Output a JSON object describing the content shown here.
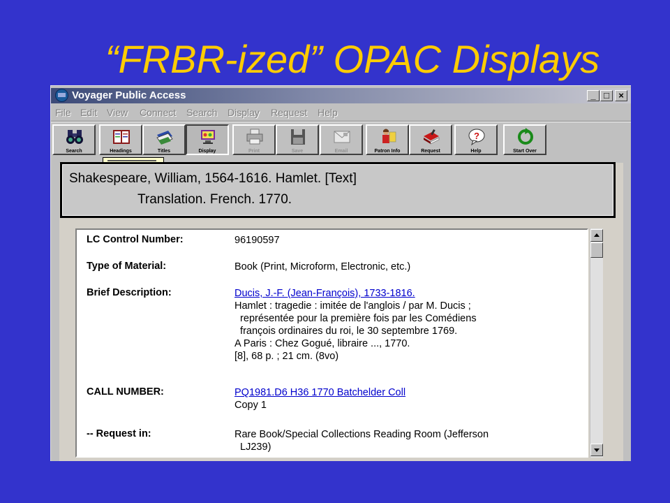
{
  "slide": {
    "title": "“FRBR-ized” OPAC Displays"
  },
  "window": {
    "title": "Voyager Public Access",
    "controls": {
      "minimize": "_",
      "maximize": "□",
      "close": "×"
    }
  },
  "menu": [
    "File",
    "Edit",
    "View",
    "Connect",
    "Search",
    "Display",
    "Request",
    "Help"
  ],
  "toolbar": [
    {
      "label": "Search",
      "icon": "binoculars-icon",
      "enabled": true
    },
    {
      "label": "Headings",
      "icon": "book-list-icon",
      "enabled": true
    },
    {
      "label": "Titles",
      "icon": "books-icon",
      "enabled": true
    },
    {
      "label": "Display",
      "icon": "display-icon",
      "enabled": true
    },
    {
      "label": "Print",
      "icon": "printer-icon",
      "enabled": false
    },
    {
      "label": "Save",
      "icon": "floppy-disk-icon",
      "enabled": false
    },
    {
      "label": "Email",
      "icon": "envelope-icon",
      "enabled": false
    },
    {
      "label": "Patron Info",
      "icon": "patron-icon",
      "enabled": true
    },
    {
      "label": "Request",
      "icon": "request-book-icon",
      "enabled": true
    },
    {
      "label": "Help",
      "icon": "help-bubble-icon",
      "enabled": true
    },
    {
      "label": "Start Over",
      "icon": "start-over-icon",
      "enabled": true
    }
  ],
  "heading_box": {
    "line1": "Shakespeare, William, 1564-1616.  Hamlet. [Text]",
    "line2": "Translation.  French.  1770."
  },
  "record": {
    "lc_control": {
      "label": "LC Control Number:",
      "value": "96190597"
    },
    "type_material": {
      "label": "Type of Material:",
      "value": "Book (Print, Microform, Electronic, etc.)"
    },
    "brief": {
      "label": "Brief Description:",
      "author_link": "Ducis, J.-F. (Jean-François), 1733-1816.",
      "lines": [
        "Hamlet : tragedie : imitée de l'anglois / par M. Ducis ;",
        "  représentée pour la première fois par les Comédiens",
        "  françois ordinaires du roi, le 30 septembre 1769.",
        "A Paris : Chez Gogué, libraire ..., 1770.",
        "[8], 68 p. ; 21 cm. (8vo)"
      ]
    },
    "call_number": {
      "label": "CALL NUMBER:",
      "link": "PQ1981.D6 H36 1770 Batchelder Coll",
      "copy": "Copy 1"
    },
    "request_in": {
      "label": "-- Request in:",
      "lines": [
        "Rare Book/Special Collections Reading Room (Jefferson",
        "  LJ239)"
      ]
    }
  }
}
